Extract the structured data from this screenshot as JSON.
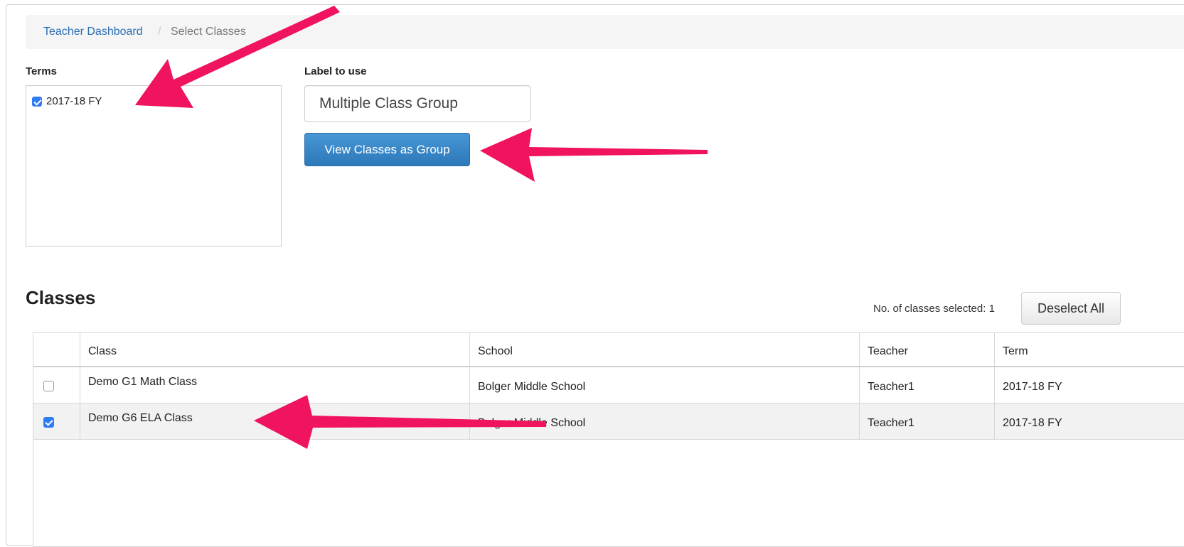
{
  "breadcrumb": {
    "home": "Teacher Dashboard",
    "separator": "/",
    "current": "Select Classes"
  },
  "terms": {
    "label": "Terms",
    "items": [
      {
        "label": "2017-18 FY",
        "checked": true
      }
    ]
  },
  "label_to_use": {
    "label": "Label to use",
    "value": "Multiple Class Group"
  },
  "view_button": "View Classes as Group",
  "classes": {
    "title": "Classes",
    "selected_count": "No. of classes selected: 1",
    "deselect_all": "Deselect All",
    "columns": [
      "Class",
      "School",
      "Teacher",
      "Term"
    ],
    "rows": [
      {
        "checked": false,
        "class": "Demo G1 Math Class",
        "school": "Bolger Middle School",
        "teacher": "Teacher1",
        "term": "2017-18 FY"
      },
      {
        "checked": true,
        "class": "Demo G6 ELA Class",
        "school": "Bolger Middle School",
        "teacher": "Teacher1",
        "term": "2017-18 FY"
      }
    ]
  },
  "colors": {
    "primary_button": "#337ab7",
    "link": "#2a6db3",
    "checkbox": "#2e7cf6",
    "annotation_arrow": "#f0135f"
  }
}
